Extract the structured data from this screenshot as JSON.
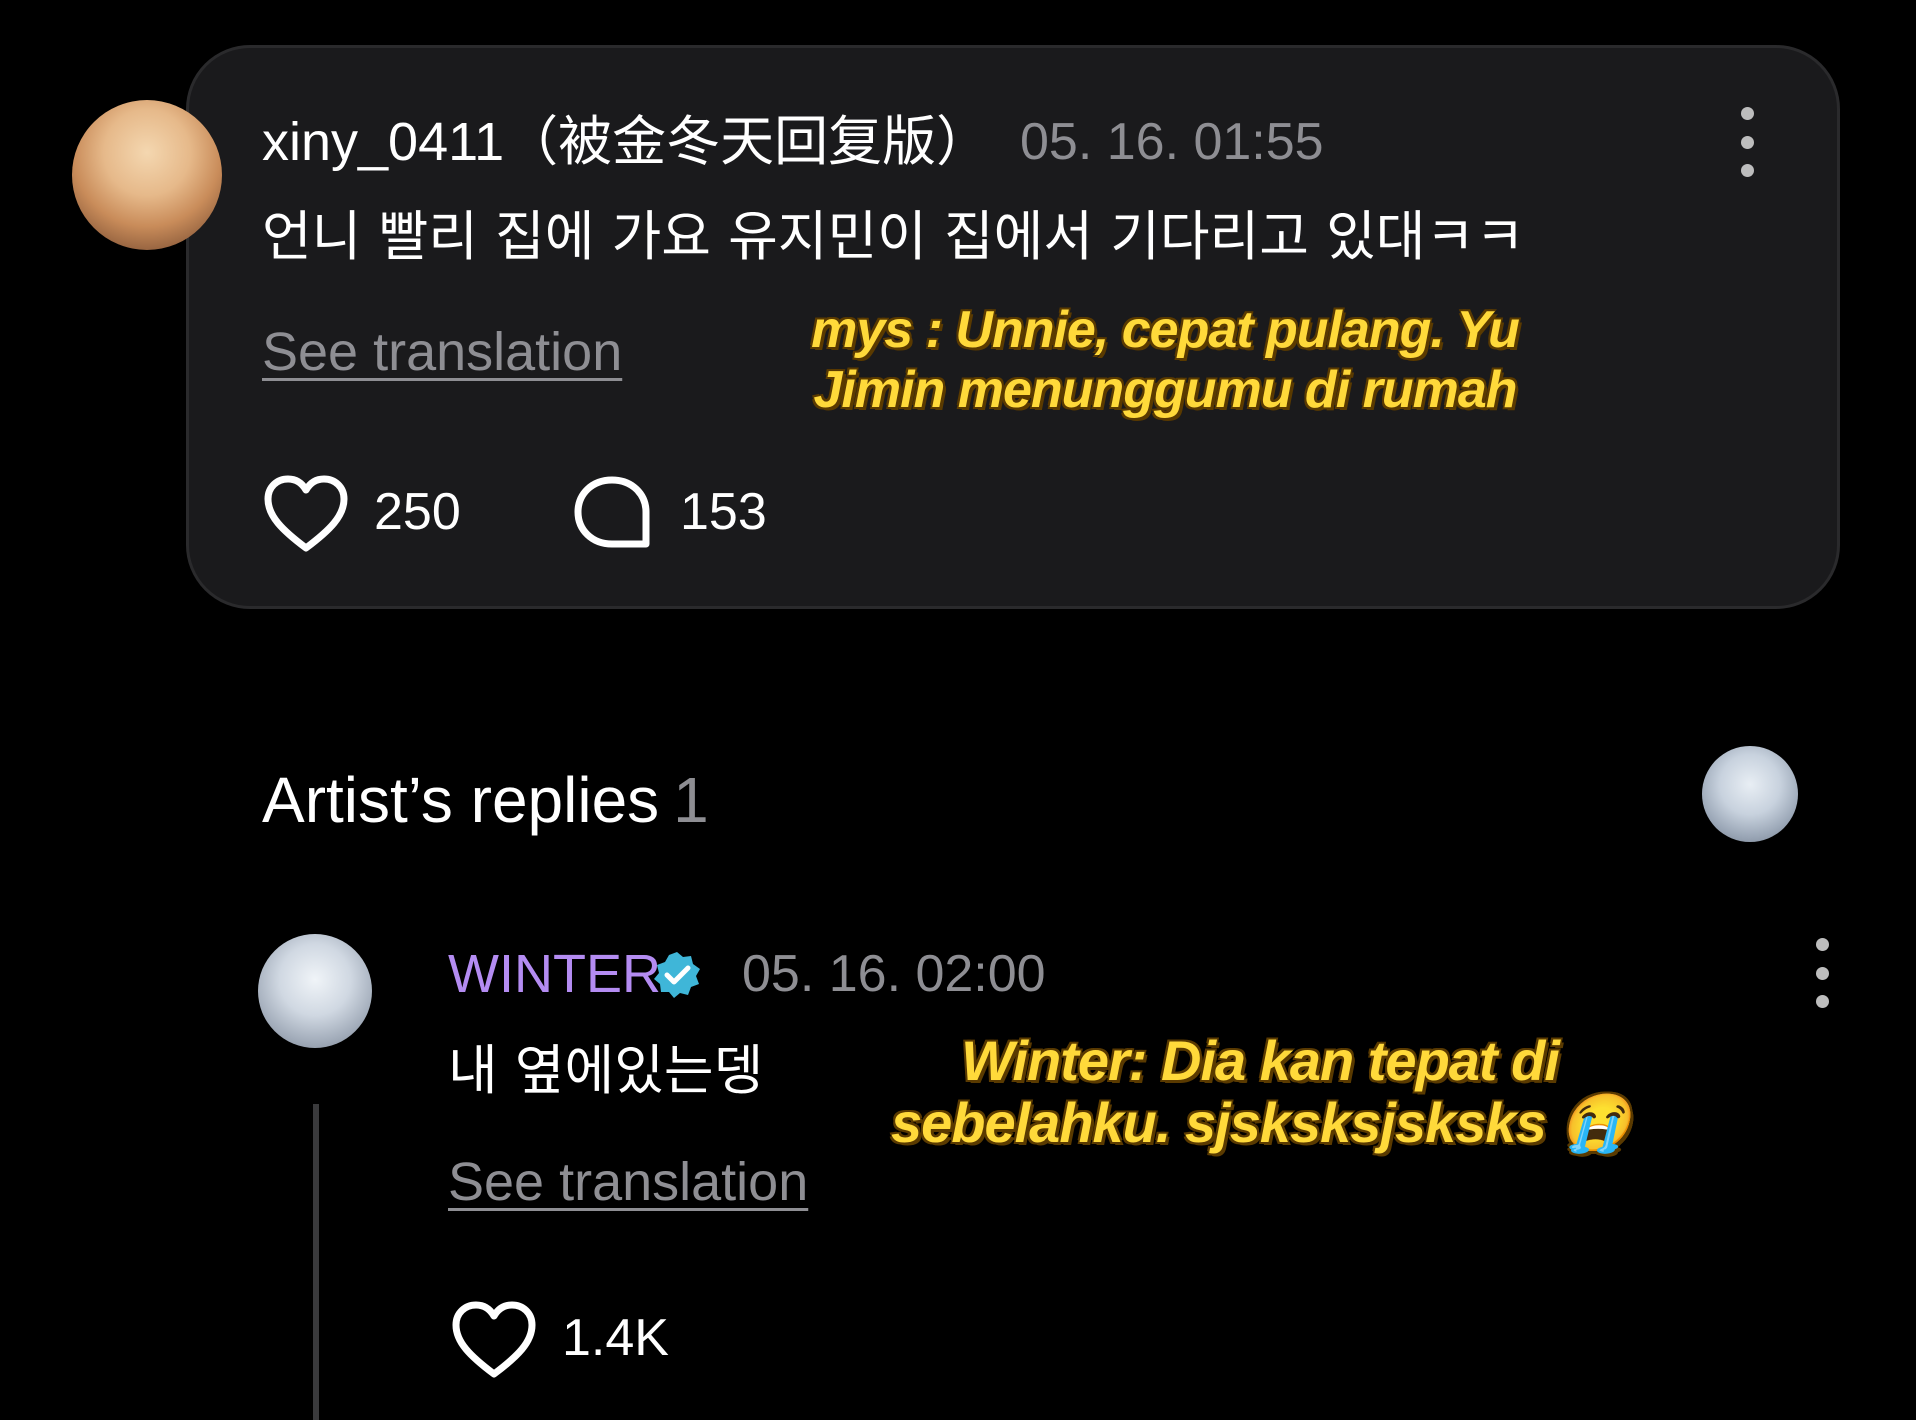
{
  "post": {
    "username": "xiny_0411（被金冬天回复版）",
    "timestamp": "05. 16. 01:55",
    "text": "언니 빨리 집에 가요 유지민이 집에서 기다리고 있대ㅋㅋ",
    "see_translation": "See translation",
    "overlay_caption_line1": "mys : Unnie, cepat pulang. Yu",
    "overlay_caption_line2": "Jimin menunggumu di rumah",
    "likes": "250",
    "comments": "153"
  },
  "replies_section": {
    "title": "Artist’s replies",
    "count": "1"
  },
  "reply": {
    "artist_name": "WINTER",
    "timestamp": "05. 16. 02:00",
    "text": "내 옆에있는뎅",
    "see_translation": "See translation",
    "overlay_caption_line1": "Winter: Dia kan tepat di",
    "overlay_caption_line2": "sebelahku. sjsksksjsksks 😭",
    "likes": "1.4K"
  },
  "colors": {
    "background": "#000000",
    "card": "#1a1a1c",
    "artist_name": "#b48cf2",
    "verified_badge": "#3fb6d8",
    "caption": "#ffd93a",
    "muted_text": "#8e8e93"
  }
}
